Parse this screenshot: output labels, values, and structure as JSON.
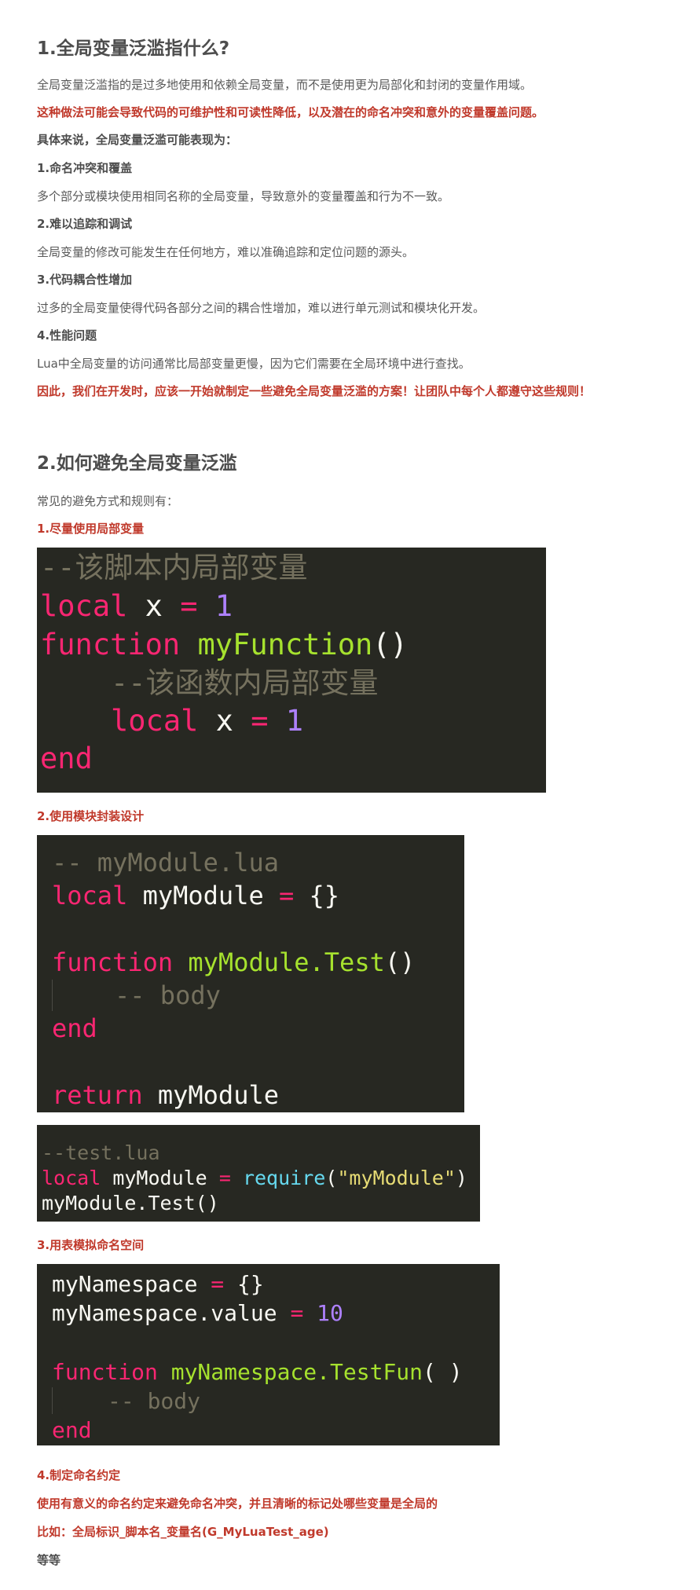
{
  "s1": {
    "title": "1.全局变量泛滥指什么?",
    "intro": "全局变量泛滥指的是过多地使用和依赖全局变量，而不是使用更为局部化和封闭的变量作用域。",
    "warning": "这种做法可能会导致代码的可维护性和可读性降低，以及潜在的命名冲突和意外的变量覆盖问题。",
    "lead": "具体来说，全局变量泛滥可能表现为：",
    "items": [
      {
        "title": "1.命名冲突和覆盖",
        "desc": "多个部分或模块使用相同名称的全局变量，导致意外的变量覆盖和行为不一致。"
      },
      {
        "title": "2.难以追踪和调试",
        "desc": "全局变量的修改可能发生在任何地方，难以准确追踪和定位问题的源头。"
      },
      {
        "title": "3.代码耦合性增加",
        "desc": "过多的全局变量使得代码各部分之间的耦合性增加，难以进行单元测试和模块化开发。"
      },
      {
        "title": "4.性能问题",
        "desc": "Lua中全局变量的访问通常比局部变量更慢，因为它们需要在全局环境中进行查找。"
      }
    ],
    "conclusion": "因此，我们在开发时，应该一开始就制定一些避免全局变量泛滥的方案！让团队中每个人都遵守这些规则！"
  },
  "s2": {
    "title": "2.如何避免全局变量泛滥",
    "intro": "常见的避免方式和规则有：",
    "rule1": "1.尽量使用局部变量",
    "rule2": "2.使用模块封装设计",
    "rule3": "3.用表模拟命名空间",
    "rule4": "4.制定命名约定",
    "rule4_desc": "使用有意义的命名约定来避免命名冲突，并且清晰的标记处哪些变量是全局的",
    "rule4_example": "比如：全局标识_脚本名_变量名(G_MyLuaTest_age)",
    "etc": "等等"
  },
  "code1": {
    "comment1": "--该脚本内局部变量",
    "kw_local": "local",
    "var_x": "x",
    "op_eq": "=",
    "num_1": "1",
    "kw_function": "function",
    "fn_name": "myFunction",
    "parens": "()",
    "comment2": "--该函数内局部变量",
    "kw_end": "end"
  },
  "code2": {
    "comment1": "-- myModule.lua",
    "kw_local": "local",
    "var_name": "myModule",
    "op_eq": "=",
    "braces": "{}",
    "kw_function": "function",
    "fn_name": "myModule.Test",
    "parens": "()",
    "comment2": "-- body",
    "kw_end": "end",
    "kw_return": "return",
    "ret_name": "myModule"
  },
  "code3": {
    "comment1": "--test.lua",
    "kw_local": "local",
    "var_name": "myModule",
    "op_eq": "=",
    "fn_require": "require",
    "open": "(",
    "str": "\"myModule\"",
    "close": ")",
    "call": "myModule.Test()"
  },
  "code4": {
    "ns": "myNamespace",
    "op_eq": "=",
    "braces": "{}",
    "ns_value": "myNamespace.value",
    "num_10": "10",
    "kw_function": "function",
    "fn_name": "myNamespace.TestFun",
    "parens": "( )",
    "comment": "-- body",
    "kw_end": "end"
  }
}
